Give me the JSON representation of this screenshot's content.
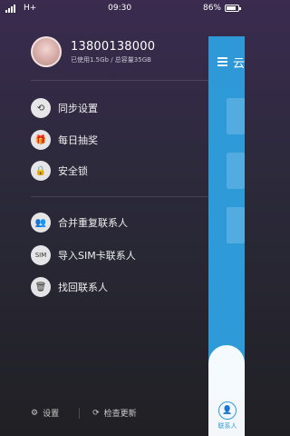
{
  "statusbar": {
    "network": "H+",
    "time": "09:30",
    "battery": "86%",
    "battery_level": 0.86
  },
  "profile": {
    "phone": "13800138000",
    "storage": "已使用1.5Gb / 总容量35GB"
  },
  "menu": {
    "sync": "同步设置",
    "lottery": "每日抽奖",
    "security": "安全锁",
    "merge": "合并重复联系人",
    "import_sim": "导入SIM卡联系人",
    "recover": "找回联系人"
  },
  "footer": {
    "settings": "设置",
    "update": "检查更新"
  },
  "peek": {
    "title": "云",
    "contact_label": "联系人"
  },
  "colors": {
    "accent": "#2e9ad8",
    "drawer_top": "#3a2b4f",
    "drawer_bottom": "#202024"
  }
}
